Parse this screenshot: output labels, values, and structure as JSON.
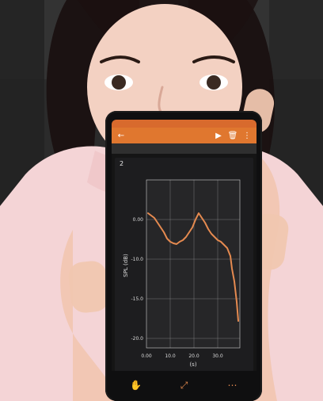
{
  "phone_ui": {
    "status": {
      "time": "",
      "signal": ""
    },
    "appbar": {
      "title": "",
      "icons": [
        "play-icon",
        "trash-icon",
        "more-icon"
      ]
    },
    "tabs": [
      {
        "label": "",
        "active": true
      },
      {
        "label": "",
        "active": false
      },
      {
        "label": "",
        "active": false
      }
    ],
    "panel": {
      "header_number": "2",
      "header_title": ""
    },
    "chart": {
      "ylabel": "SPL (dB)",
      "xlabel": "(s)",
      "xticks": [
        "0.00",
        "10.0",
        "20.0",
        "30.0"
      ],
      "yticks": [
        "0.00",
        "-10.0",
        "-15.0",
        "-20.0"
      ],
      "series": {
        "color": "#e58a50"
      }
    },
    "bottom_nav": [
      {
        "label": "",
        "active": true,
        "icon": "hand-icon"
      },
      {
        "label": "",
        "active": false,
        "icon": "expand-icon"
      },
      {
        "label": "",
        "active": false,
        "icon": "dots-icon"
      }
    ]
  }
}
